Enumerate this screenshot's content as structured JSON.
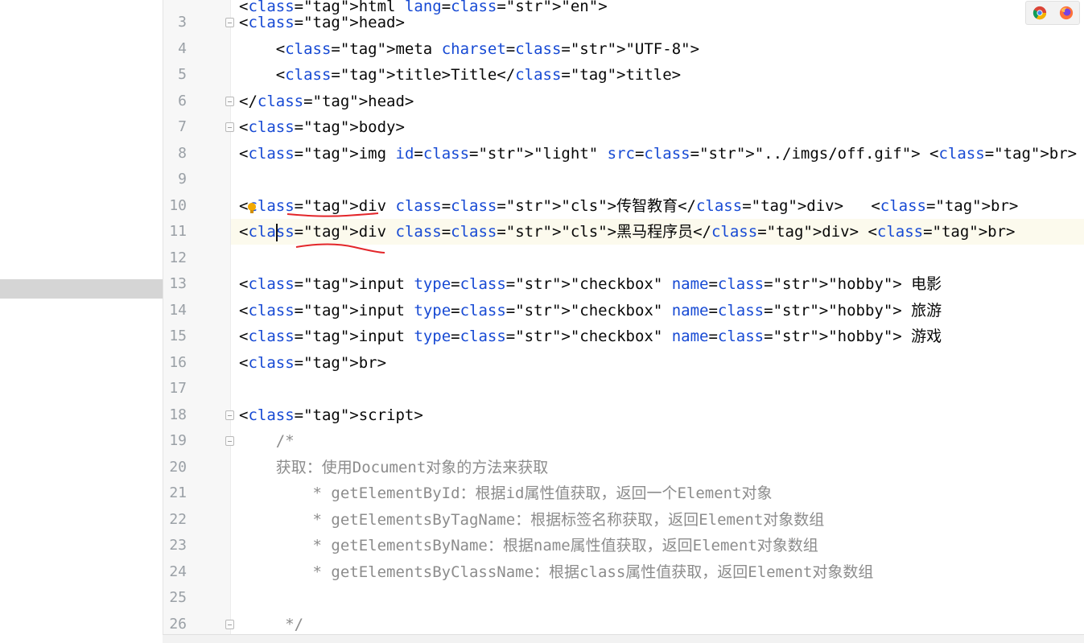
{
  "editor": {
    "lines": [
      {
        "n": "",
        "t": "<html lang=\"en\">"
      },
      {
        "n": "3",
        "t": "<head>"
      },
      {
        "n": "4",
        "t": "    <meta charset=\"UTF-8\">"
      },
      {
        "n": "5",
        "t": "    <title>Title</title>"
      },
      {
        "n": "6",
        "t": "</head>"
      },
      {
        "n": "7",
        "t": "<body>"
      },
      {
        "n": "8",
        "t": "<img id=\"light\" src=\"../imgs/off.gif\"> <br>"
      },
      {
        "n": "9",
        "t": ""
      },
      {
        "n": "10",
        "t": "<div class=\"cls\">传智教育</div>   <br>"
      },
      {
        "n": "11",
        "t": "<div class=\"cls\">黑马程序员</div> <br>"
      },
      {
        "n": "12",
        "t": ""
      },
      {
        "n": "13",
        "t": "<input type=\"checkbox\" name=\"hobby\"> 电影"
      },
      {
        "n": "14",
        "t": "<input type=\"checkbox\" name=\"hobby\"> 旅游"
      },
      {
        "n": "15",
        "t": "<input type=\"checkbox\" name=\"hobby\"> 游戏"
      },
      {
        "n": "16",
        "t": "<br>"
      },
      {
        "n": "17",
        "t": ""
      },
      {
        "n": "18",
        "t": "<script>"
      },
      {
        "n": "19",
        "t": "    /*"
      },
      {
        "n": "20",
        "t": "    获取：使用Document对象的方法来获取"
      },
      {
        "n": "21",
        "t": "        * getElementById：根据id属性值获取，返回一个Element对象"
      },
      {
        "n": "22",
        "t": "        * getElementsByTagName：根据标签名称获取，返回Element对象数组"
      },
      {
        "n": "23",
        "t": "        * getElementsByName：根据name属性值获取，返回Element对象数组"
      },
      {
        "n": "24",
        "t": "        * getElementsByClassName：根据class属性值获取，返回Element对象数组"
      },
      {
        "n": "25",
        "t": ""
      },
      {
        "n": "26",
        "t": "     */"
      }
    ],
    "current_line": "11"
  },
  "browser_icons": [
    "chrome-icon",
    "firefox-icon"
  ],
  "colors": {
    "tag": "#0033b3",
    "attribute": "#174ad4",
    "string": "#067d17",
    "comment": "#8c8c8c",
    "annotation": "#e3262a"
  }
}
